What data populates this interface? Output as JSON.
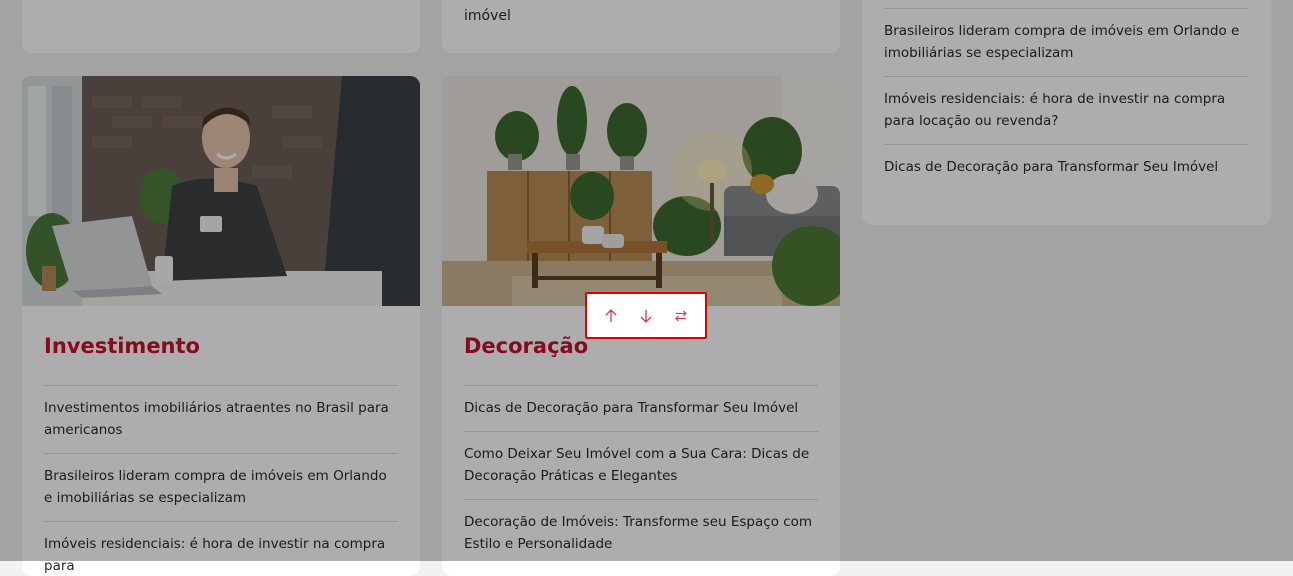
{
  "top_middle_card": {
    "fragment": "imóvel"
  },
  "right_sidebar": {
    "items": [
      {
        "label": "Brasileiros lideram compra de imóveis em Orlando e imobiliárias se especializam"
      },
      {
        "label": "Imóveis residenciais: é hora de investir na compra para locação ou revenda?"
      },
      {
        "label": "Dicas de Decoração para Transformar Seu Imóvel"
      }
    ]
  },
  "cards": [
    {
      "title": "Investimento",
      "items": [
        {
          "label": "Investimentos imobiliários atraentes no Brasil para americanos"
        },
        {
          "label": "Brasileiros lideram compra de imóveis em Orlando e imobiliárias se especializam"
        },
        {
          "label": "Imóveis residenciais: é hora de investir na compra para"
        }
      ]
    },
    {
      "title": "Decoração",
      "items": [
        {
          "label": "Dicas de Decoração para Transformar Seu Imóvel"
        },
        {
          "label": "Como Deixar Seu Imóvel com a Sua Cara: Dicas de Decoração Práticas e Elegantes"
        },
        {
          "label": "Decoração de Imóveis: Transforme seu Espaço com Estilo e Personalidade"
        }
      ]
    }
  ],
  "toolbar": {
    "buttons": [
      {
        "icon": "arrow-up-icon"
      },
      {
        "icon": "arrow-down-icon"
      },
      {
        "icon": "swap-icon"
      }
    ]
  },
  "colors": {
    "accent": "#c8102e",
    "toolbar_border": "#e00000",
    "toolbar_icon": "#e0354f",
    "overlay": "rgba(0,0,0,0.32)"
  }
}
